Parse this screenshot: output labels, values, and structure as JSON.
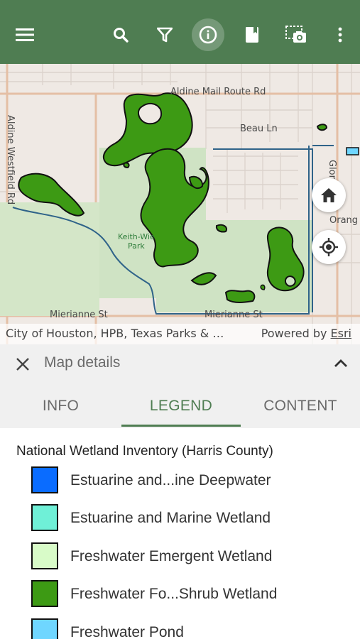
{
  "toolbar": {
    "menu_icon": "menu-icon",
    "search_icon": "search-icon",
    "filter_icon": "filter-icon",
    "info_icon": "info-icon",
    "bookmark_icon": "bookmark-icon",
    "screenshot_icon": "screenshot-icon",
    "more_icon": "more-vertical-icon"
  },
  "map": {
    "street_labels": {
      "aldine_mail_route": "Aldine Mail Route Rd",
      "beau_ln": "Beau Ln",
      "aldine_westfield": "Aldine Westfield Rd",
      "glor": "Glor",
      "orange": "Orang",
      "mierianne_left": "Mierianne St",
      "mierianne_right": "Mierianne St"
    },
    "park_label": "Keith-Wiess\nPark",
    "park_label_line1": "Keith-Wie",
    "park_label_line2": "Park",
    "home_button_icon": "home-icon",
    "locate_button_icon": "locate-icon",
    "attribution": "City of Houston, HPB, Texas Parks & …",
    "powered_by_prefix": "Powered by ",
    "powered_by_link": "Esri"
  },
  "details": {
    "title": "Map details",
    "close_icon": "close-icon",
    "collapse_icon": "chevron-up-icon"
  },
  "tabs": [
    {
      "label": "INFO",
      "active": false
    },
    {
      "label": "LEGEND",
      "active": true
    },
    {
      "label": "CONTENT",
      "active": false
    }
  ],
  "legend": {
    "title": "National Wetland Inventory (Harris County)",
    "items": [
      {
        "label": "Estuarine and...ine Deepwater",
        "color": "#0a6cff"
      },
      {
        "label": "Estuarine and Marine Wetland",
        "color": "#6ff0d7"
      },
      {
        "label": "Freshwater Emergent Wetland",
        "color": "#d8fbc8"
      },
      {
        "label": "Freshwater Fo...Shrub Wetland",
        "color": "#3d9a14"
      },
      {
        "label": "Freshwater Pond",
        "color": "#6fd6ff"
      }
    ]
  },
  "colors": {
    "toolbar": "#4f7d52",
    "wetland_fill": "#3d9a14",
    "park_fill": "#cfe3c4",
    "accent": "#4f7d52"
  }
}
